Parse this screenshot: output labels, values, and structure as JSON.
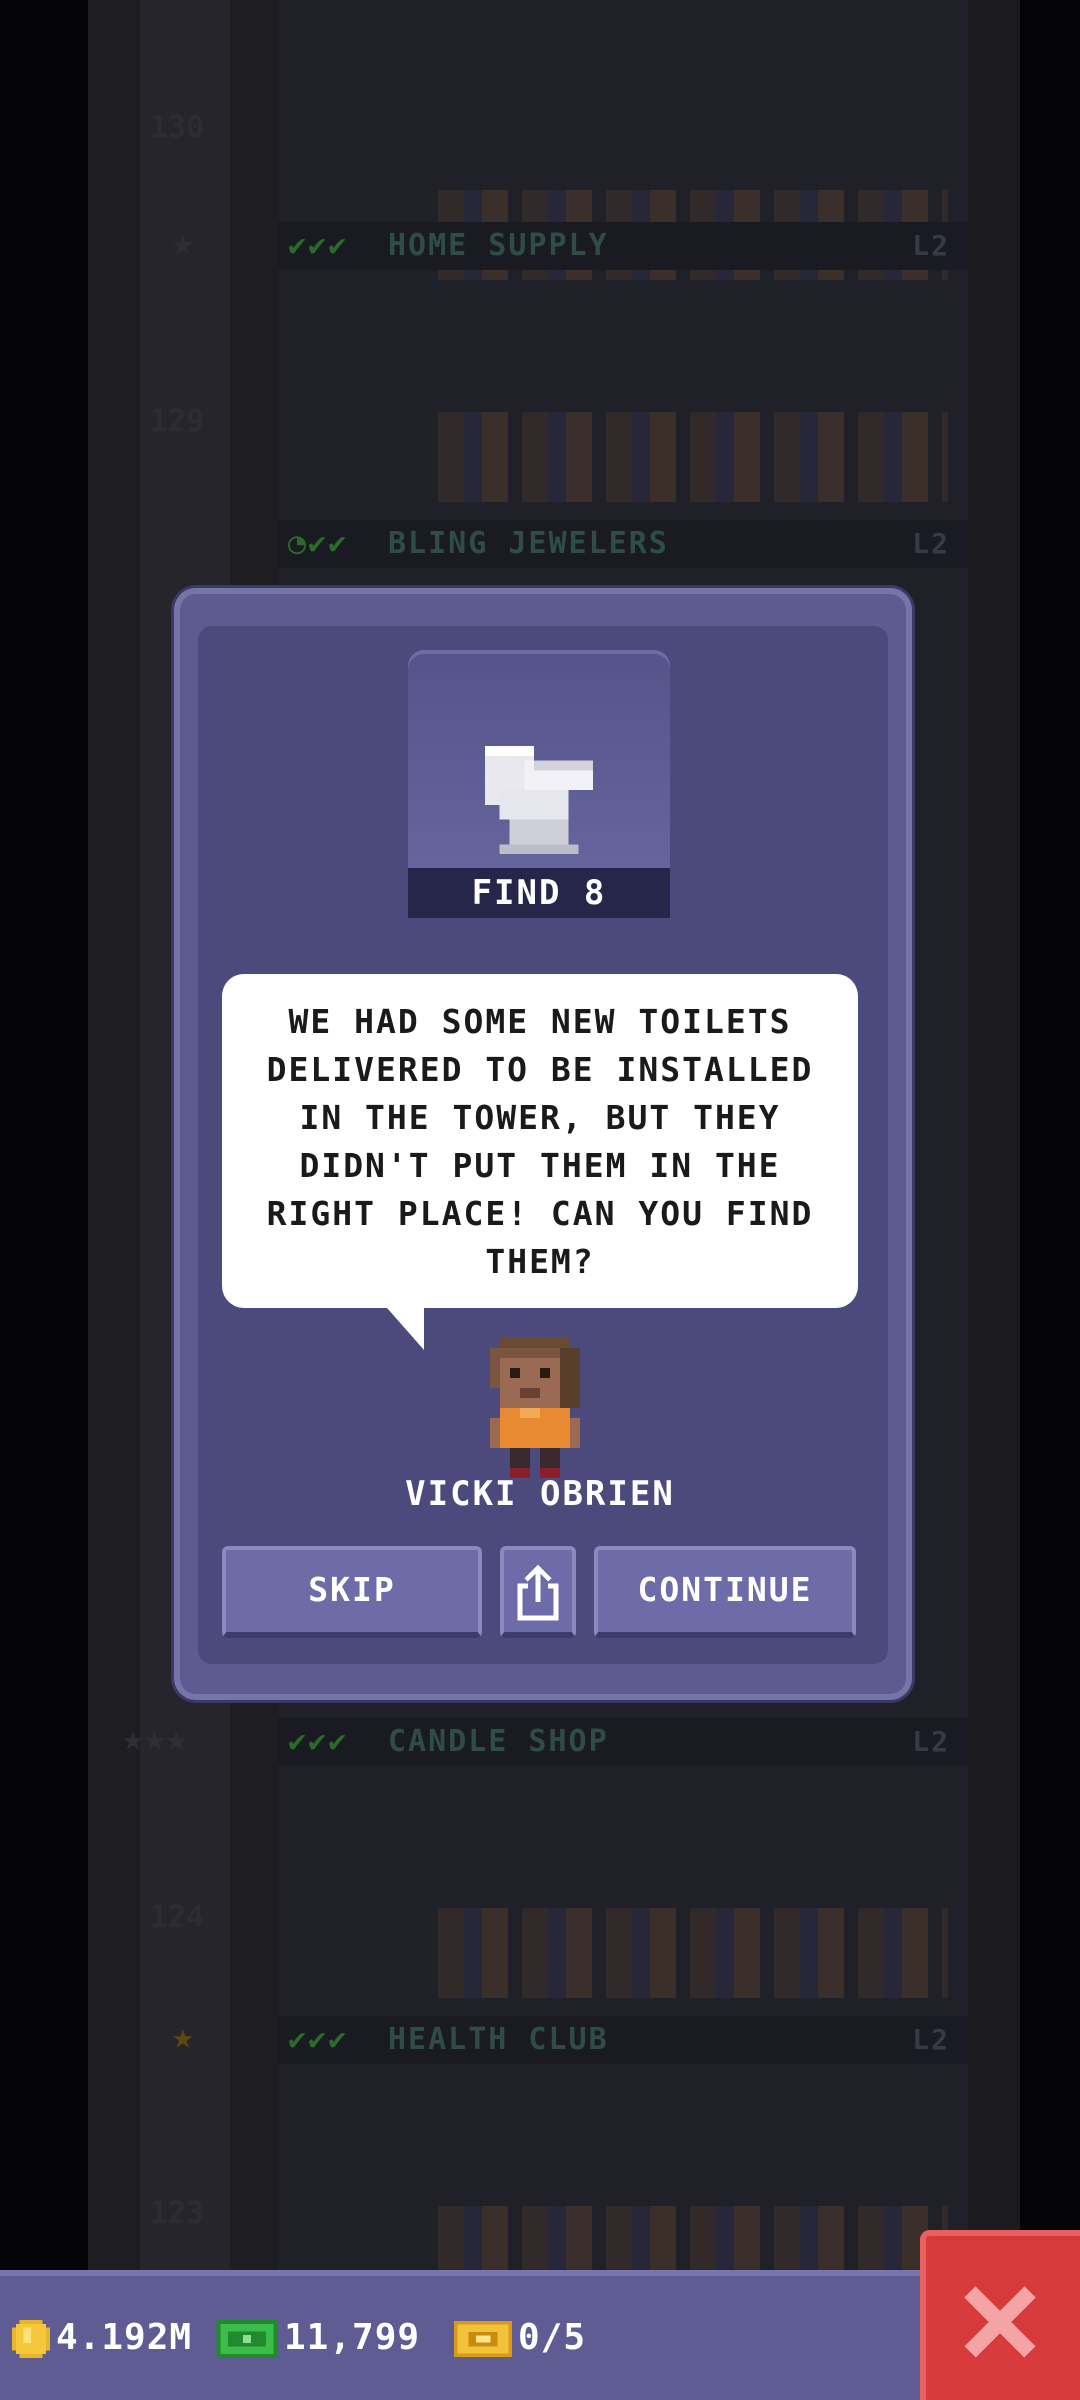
{
  "background": {
    "floors": [
      {
        "name": "HOME SUPPLY",
        "level": "L2"
      },
      {
        "name": "BLING JEWELERS",
        "level": "L2"
      },
      {
        "name": "CANDLE SHOP",
        "level": "L2"
      },
      {
        "name": "HEALTH CLUB",
        "level": "L2"
      }
    ],
    "floor_numbers": [
      "130",
      "129",
      "124",
      "123"
    ]
  },
  "dialog": {
    "item_icon": "toilet-icon",
    "item_caption": "FIND 8",
    "message": "WE HAD SOME NEW TOILETS DELIVERED TO BE INSTALLED IN THE TOWER, BUT THEY DIDN'T PUT THEM IN THE RIGHT PLACE! CAN YOU FIND THEM?",
    "character_name": "VICKI OBRIEN",
    "buttons": {
      "skip": "SKIP",
      "share_icon": "share-icon",
      "continue": "CONTINUE"
    }
  },
  "bottom_bar": {
    "coins": "4.192M",
    "bux": "11,799",
    "tickets": "0/5",
    "close_icon": "close-icon"
  },
  "colors": {
    "dialog_bg": "#5d5b8f",
    "dialog_inner": "#4c4a7c",
    "close_red": "#d63a3a",
    "bar_bg": "#5e5c92"
  }
}
